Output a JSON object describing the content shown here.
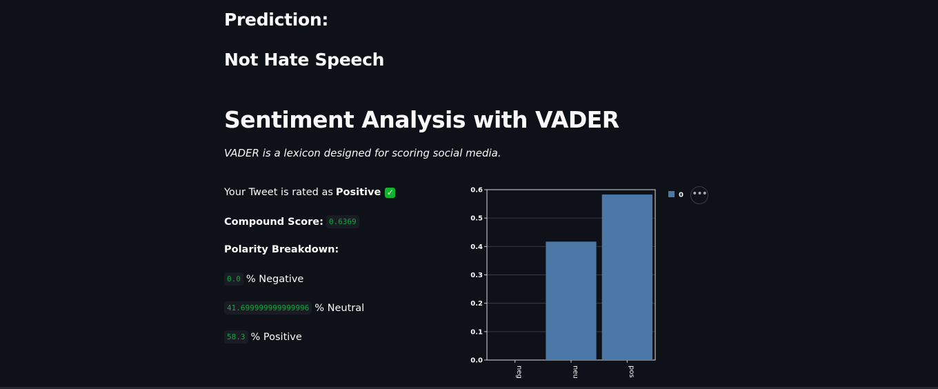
{
  "prediction": {
    "label": "Prediction:",
    "result": "Not Hate Speech"
  },
  "sentiment": {
    "title": "Sentiment Analysis with VADER",
    "description": "VADER is a lexicon designed for scoring social media.",
    "rating_prefix": "Your Tweet is rated as",
    "rating": "Positive",
    "rating_icon": "check-mark-icon",
    "compound_label": "Compound Score:",
    "compound_value": "0.6369",
    "polarity_label": "Polarity Breakdown:",
    "negative_value": "0.0",
    "negative_label": "% Negative",
    "neutral_value": "41.699999999999996",
    "neutral_label": "% Neutral",
    "positive_value": "58.3",
    "positive_label": "% Positive"
  },
  "chart_menu_icon": "more-horizontal-icon",
  "chart_data": {
    "type": "bar",
    "categories": [
      "neg",
      "neu",
      "pos"
    ],
    "series": [
      {
        "name": "0",
        "values": [
          0.0,
          0.417,
          0.583
        ],
        "color": "#4c78a8"
      }
    ],
    "yticks": [
      "0.0",
      "0.1",
      "0.2",
      "0.3",
      "0.4",
      "0.5",
      "0.6"
    ],
    "ylim": [
      0,
      0.6
    ],
    "grid": true,
    "legend": "top-right",
    "title": "",
    "xlabel": "",
    "ylabel": ""
  }
}
